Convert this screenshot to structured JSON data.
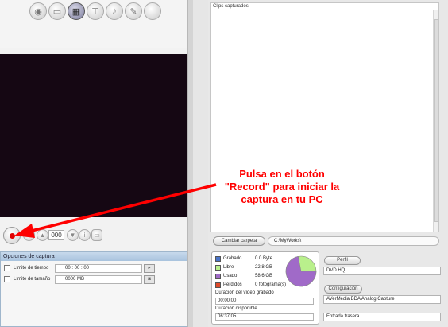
{
  "colors": {
    "video_bg": "#150713",
    "panel_header": "#b3c9e0",
    "record_red": "#e00000",
    "grabado": "#4a74c8",
    "libre": "#b9f08c",
    "usado": "#a06ac8",
    "perdidos": "#e04a2a",
    "annotation_red": "#ff0000"
  },
  "toolbar": {
    "mode_icons": [
      "disc-icon",
      "drawer-icon",
      "capture-video-icon",
      "projector-icon",
      "microphone-icon",
      "pen-icon",
      "blank-mode-icon"
    ]
  },
  "controls": {
    "counter": "000"
  },
  "capture_options": {
    "title": "Opciones de captura",
    "time_limit_label": "Límite de tiempo",
    "time_limit_value": "00 : 00 : 00",
    "size_limit_label": "Límite de tamaño",
    "size_limit_value": "0000  MB"
  },
  "clips": {
    "title": "Clips capturados"
  },
  "folder": {
    "button_label": "Cambiar carpeta",
    "path": "C:\\MyWorks\\"
  },
  "disk_stats": {
    "grabado_label": "Grabado",
    "grabado_value": "0.0  Byte",
    "libre_label": "Libre",
    "libre_value": "22.8  GB",
    "usado_label": "Usado",
    "usado_value": "58.6  GB",
    "perdidos_label": "Perdidos",
    "perdidos_value": "0 fotograma(s)",
    "recorded_duration_label": "Duración del vídeo grabado",
    "recorded_duration_value": "00:00:00",
    "available_duration_label": "Duración disponible",
    "available_duration_value": "06:37:05",
    "pie_used_fraction": 0.72
  },
  "profile": {
    "button_label": "Perfil",
    "value": "DVD HQ",
    "config_button_label": "Configuración",
    "device_value": "AVerMedia BDA Analog Capture",
    "input_value": "Entrada trasera"
  },
  "annotation": {
    "line1": "Pulsa en el botón",
    "line2": "\"Record\" para iniciar la",
    "line3": "captura en tu PC"
  }
}
